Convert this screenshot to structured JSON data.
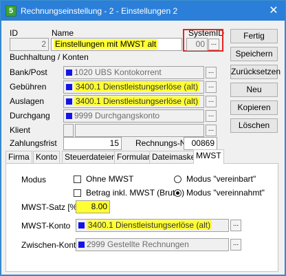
{
  "window": {
    "title": "Rechnungseinstellung - 2 -  Einstellungen 2",
    "logo": "5",
    "close_icon": "✕"
  },
  "header": {
    "id_label": "ID",
    "id_value": "2",
    "name_label": "Name",
    "name_value": "Einstellungen mit MWST alt",
    "systemid_label": "SystemID",
    "systemid_value": "00",
    "section_label": "Buchhaltung / Konten"
  },
  "accounts": {
    "bankpost_label": "Bank/Post",
    "bankpost_value": "1020 UBS Kontokorrent",
    "gebuehren_label": "Gebühren",
    "gebuehren_value": "3400.1 Dienstleistungserlöse (alt)",
    "auslagen_label": "Auslagen",
    "auslagen_value": "3400.1 Dienstleistungserlöse (alt)",
    "durchgang_label": "Durchgang",
    "durchgang_value": "9999 Durchgangskonto",
    "klient_label": "Klient",
    "zahlungsfrist_label": "Zahlungsfrist",
    "zahlungsfrist_value": "15",
    "rechnungsnr_label": "Rechnungs-Nr.",
    "rechnungsnr_value": "00869"
  },
  "buttons": {
    "fertig": "Fertig",
    "speichern": "Speichern",
    "zuruecksetzen": "Zurücksetzen",
    "neu": "Neu",
    "kopieren": "Kopieren",
    "loeschen": "Löschen",
    "dots": "..."
  },
  "tabs": [
    "Firma",
    "Konto",
    "Steuerdateien",
    "Formular",
    "Dateimaske",
    "MWST"
  ],
  "mwst": {
    "modus_label": "Modus",
    "ohne_mwst": "Ohne MWST",
    "betrag_inkl": "Betrag inkl. MWST (Brutto)",
    "modus_vereinbart": "Modus \"vereinbart\"",
    "modus_vereinnahmt": "Modus \"vereinnahmt\"",
    "satz_label": "MWST-Satz [%]",
    "satz_value": "8.00",
    "konto_label": "MWST-Konto",
    "konto_value": "3400.1 Dienstleistungserlöse (alt)",
    "zwischen_label": "Zwischen-Konto",
    "zwischen_value": "2999 Gestellte Rechnungen"
  },
  "colors": {
    "titlebar": "#2b7fd8",
    "highlight": "#ffff33",
    "systemid_frame": "#e8231f",
    "account_square": "#1414e6"
  }
}
